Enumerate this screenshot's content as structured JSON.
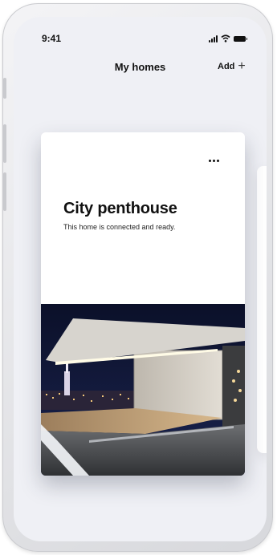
{
  "status_bar": {
    "time": "9:41",
    "icons": [
      "signal-icon",
      "wifi-icon",
      "battery-icon"
    ]
  },
  "header": {
    "title": "My homes",
    "add_label": "Add",
    "add_icon": "plus-icon"
  },
  "home_card": {
    "title": "City penthouse",
    "subtitle": "This home is connected and ready.",
    "menu_icon": "more-dots-icon",
    "image": "penthouse-night-photo"
  },
  "colors": {
    "background": "#eff0f5",
    "card": "#ffffff",
    "text": "#111111",
    "night_sky": "#0e1430"
  }
}
